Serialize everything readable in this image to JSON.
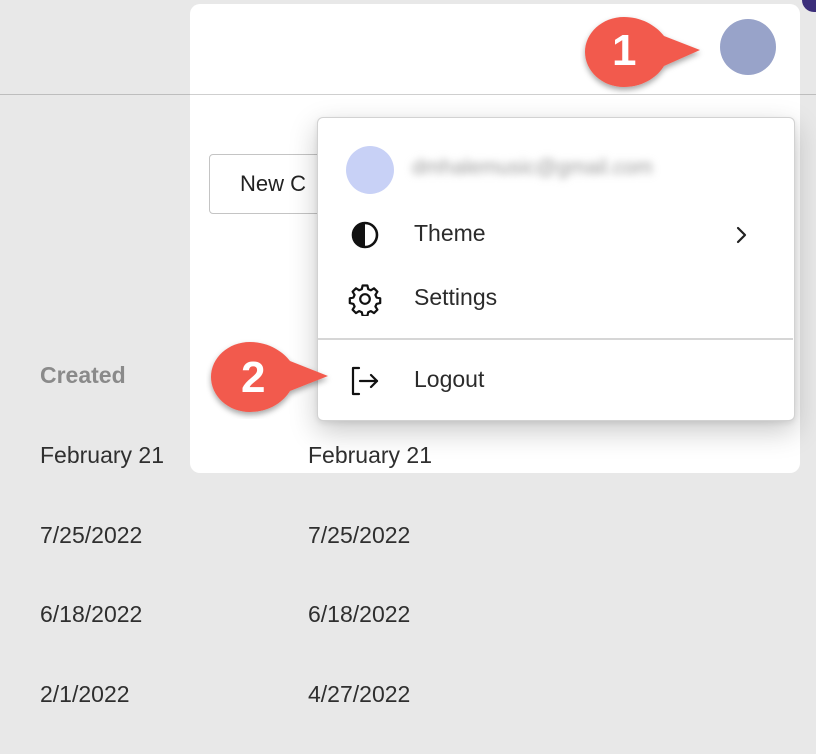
{
  "header": {
    "avatar": "user-avatar"
  },
  "toolbar": {
    "new_button_label": "New C"
  },
  "table": {
    "column_header": "Created",
    "rows": [
      {
        "created": "February 21",
        "updated": "February 21"
      },
      {
        "created": "7/25/2022",
        "updated": "7/25/2022"
      },
      {
        "created": "6/18/2022",
        "updated": "6/18/2022"
      },
      {
        "created": "2/1/2022",
        "updated": "4/27/2022"
      }
    ]
  },
  "user_menu": {
    "email": "dmhalemusic@gmail.com",
    "items": [
      {
        "label": "Theme",
        "icon": "contrast-icon",
        "has_submenu": true
      },
      {
        "label": "Settings",
        "icon": "gear-icon",
        "has_submenu": false
      },
      {
        "label": "Logout",
        "icon": "logout-icon",
        "has_submenu": false
      }
    ]
  },
  "callouts": [
    {
      "number": "1"
    },
    {
      "number": "2"
    }
  ],
  "colors": {
    "callout": "#f25a4d",
    "avatar": "#98a3c9",
    "menu_avatar": "#c8d1f6",
    "background": "#e8e8e8"
  }
}
